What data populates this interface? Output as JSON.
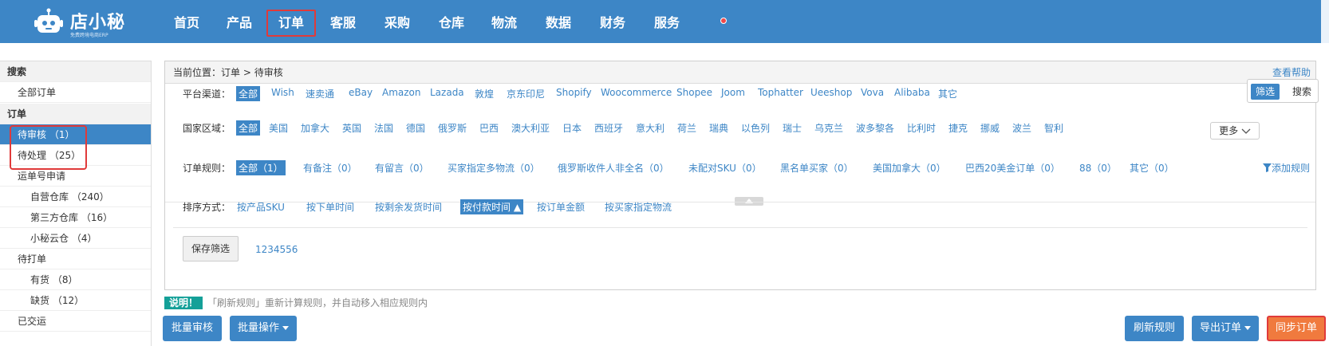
{
  "app": {
    "brand": "店小秘",
    "slogan": "免费跨境电商ERP"
  },
  "nav": {
    "items": [
      {
        "label": "首页"
      },
      {
        "label": "产品"
      },
      {
        "label": "订单"
      },
      {
        "label": "客服"
      },
      {
        "label": "采购"
      },
      {
        "label": "仓库"
      },
      {
        "label": "物流"
      },
      {
        "label": "数据"
      },
      {
        "label": "财务"
      },
      {
        "label": "服务"
      }
    ],
    "active": "订单"
  },
  "sidebar": {
    "search_head": "搜索",
    "all_orders": "全部订单",
    "order_head": "订单",
    "items": [
      {
        "label": "待审核 （1）"
      },
      {
        "label": "待处理 （25）"
      },
      {
        "label": "运单号申请"
      },
      {
        "label": "自营仓库 （240）"
      },
      {
        "label": "第三方仓库 （16）"
      },
      {
        "label": "小秘云仓 （4）"
      },
      {
        "label": "待打单"
      },
      {
        "label": "有货 （8）"
      },
      {
        "label": "缺货 （12）"
      },
      {
        "label": "已交运"
      }
    ]
  },
  "breadcrumb": {
    "prefix": "当前位置：",
    "path": "订单 > 待审核",
    "help": "查看帮助"
  },
  "filters": {
    "platform_label": "平台渠道：",
    "platforms": [
      "全部",
      "Wish",
      "速卖通",
      "eBay",
      "Amazon",
      "Lazada",
      "敦煌",
      "京东印尼",
      "Shopify",
      "Woocommerce",
      "Shopee",
      "Joom",
      "Tophatter",
      "Ueeshop",
      "Vova",
      "Alibaba",
      "其它"
    ],
    "country_label": "国家区域：",
    "countries": [
      "全部",
      "美国",
      "加拿大",
      "英国",
      "法国",
      "德国",
      "俄罗斯",
      "巴西",
      "澳大利亚",
      "日本",
      "西班牙",
      "意大利",
      "荷兰",
      "瑞典",
      "以色列",
      "瑞士",
      "乌克兰",
      "波多黎各",
      "比利时",
      "捷克",
      "挪威",
      "波兰",
      "智利"
    ],
    "more": "更多",
    "rule_label": "订单规则：",
    "rules": [
      "全部（1）",
      "有备注（0）",
      "有留言（0）",
      "买家指定多物流（0）",
      "俄罗斯收件人非全名（0）",
      "未配对SKU（0）",
      "黑名单买家（0）",
      "美国加拿大（0）",
      "巴西20美金订单（0）",
      "88（0）",
      "其它（0）"
    ],
    "add_rule": "添加规则",
    "sort_label": "排序方式：",
    "sorts": [
      "按产品SKU",
      "按下单时间",
      "按剩余发货时间",
      "按付款时间",
      "按订单金额",
      "按买家指定物流"
    ],
    "sort_active": "按付款时间",
    "save_filter": "保存筛选",
    "saved_filter": "1234556",
    "toggle_filter": "筛选",
    "toggle_search": "搜索"
  },
  "note": {
    "tag": "说明！",
    "text": "「刷新规则」重新计算规则，并自动移入相应规则内"
  },
  "actions": {
    "batch_review": "批量审核",
    "batch_ops": "批量操作",
    "refresh_rules": "刷新规则",
    "export_orders": "导出订单",
    "sync_orders": "同步订单"
  },
  "colors": {
    "primary": "#3d86c6",
    "highlight": "#e03a3a",
    "sync": "#f07a3e",
    "note_tag": "#14a098"
  }
}
